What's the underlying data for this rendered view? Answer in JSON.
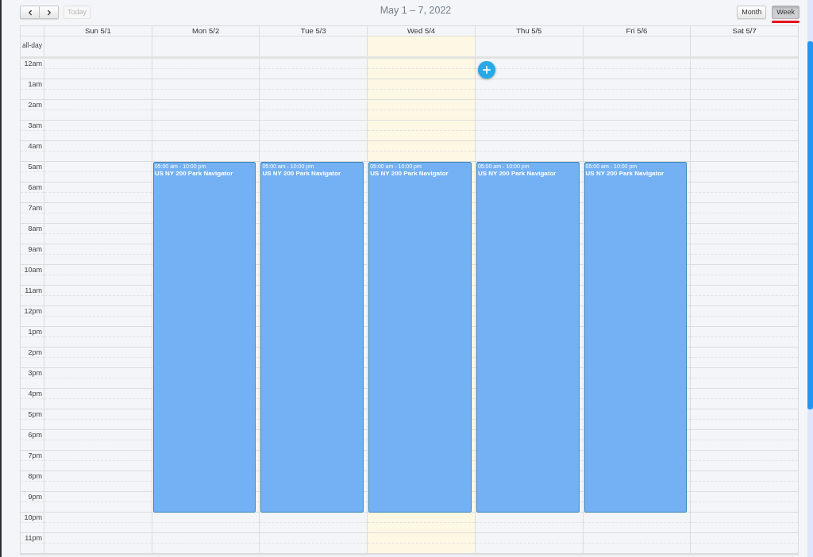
{
  "toolbar": {
    "today_button": {
      "label": "Today",
      "disabled": true
    },
    "title": "May 1 – 7, 2022",
    "views": [
      {
        "label": "Month",
        "selected": false,
        "underlined": false
      },
      {
        "label": "Week",
        "selected": true,
        "underlined": true
      }
    ]
  },
  "calendar": {
    "all_day_label": "all-day",
    "days": [
      {
        "label": "Sun 5/1",
        "today": false
      },
      {
        "label": "Mon 5/2",
        "today": false,
        "events": [
          {
            "time": "05:00 am - 10:00 pm",
            "title": "US NY 200 Park Navigator"
          }
        ]
      },
      {
        "label": "Tue 5/3",
        "today": false,
        "events": [
          {
            "time": "05:00 am - 10:00 pm",
            "title": "US NY 200 Park Navigator"
          }
        ]
      },
      {
        "label": "Wed 5/4",
        "today": true,
        "events": [
          {
            "time": "05:00 am - 10:00 pm",
            "title": "US NY 200 Park Navigator"
          }
        ]
      },
      {
        "label": "Thu 5/5",
        "today": false,
        "events": [
          {
            "time": "05:00 am - 10:00 pm",
            "title": "US NY 200 Park Navigator"
          }
        ]
      },
      {
        "label": "Fri 5/6",
        "today": false,
        "events": [
          {
            "time": "05:00 am - 10:00 pm",
            "title": "US NY 200 Park Navigator"
          }
        ]
      },
      {
        "label": "Sat 5/7",
        "today": false
      }
    ],
    "hours": [
      "12am",
      "1am",
      "2am",
      "3am",
      "4am",
      "5am",
      "6am",
      "7am",
      "8am",
      "9am",
      "10am",
      "11am",
      "12pm",
      "1pm",
      "2pm",
      "3pm",
      "4pm",
      "5pm",
      "6pm",
      "7pm",
      "8pm",
      "9pm",
      "10pm",
      "11pm"
    ]
  }
}
